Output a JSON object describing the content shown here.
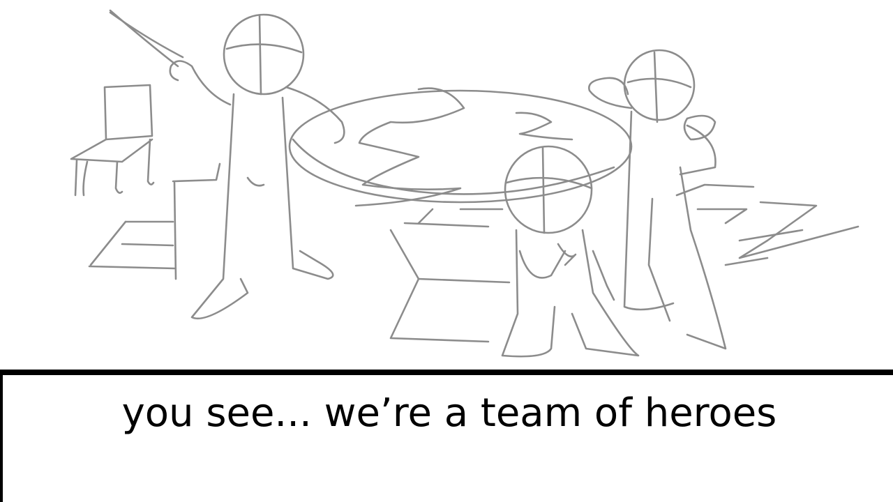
{
  "caption": {
    "text": "you see... we’re a team of heroes"
  },
  "colors": {
    "sketch_stroke": "#8c8c8c",
    "caption_border": "#000000",
    "caption_text": "#000000",
    "background": "#ffffff"
  }
}
